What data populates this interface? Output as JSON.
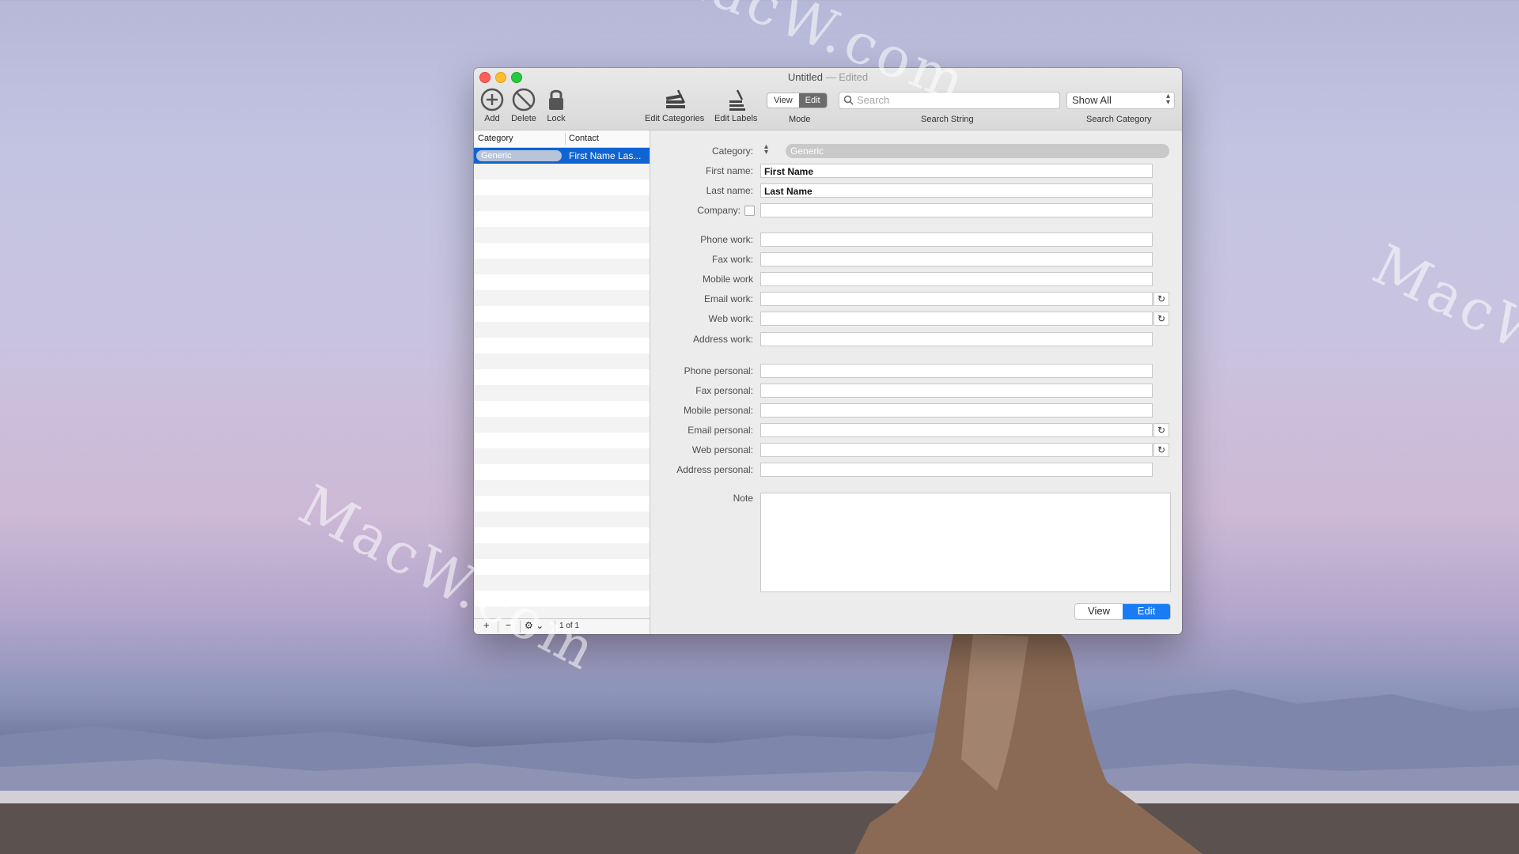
{
  "window": {
    "title": "Untitled",
    "title_suffix": "— Edited"
  },
  "toolbar": {
    "add_label": "Add",
    "delete_label": "Delete",
    "lock_label": "Lock",
    "edit_categories_label": "Edit Categories",
    "edit_labels_label": "Edit Labels",
    "mode_view": "View",
    "mode_edit": "Edit",
    "mode_caption": "Mode",
    "search_placeholder": "Search",
    "search_caption": "Search String",
    "category_value": "Show All",
    "category_caption": "Search Category"
  },
  "list": {
    "headers": [
      "Category",
      "Contact"
    ],
    "rows": [
      {
        "category": "Generic",
        "contact": "First Name Las..."
      }
    ],
    "footer_count": "1 of 1"
  },
  "form": {
    "category_label": "Category:",
    "category_value": "Generic",
    "fields": [
      {
        "label": "First name:",
        "value": "First Name"
      },
      {
        "label": "Last name:",
        "value": "Last Name"
      },
      {
        "label": "Company:",
        "value": ""
      },
      {
        "label": "Phone work:",
        "value": ""
      },
      {
        "label": "Fax work:",
        "value": ""
      },
      {
        "label": "Mobile work",
        "value": ""
      },
      {
        "label": "Email work:",
        "value": ""
      },
      {
        "label": "Web work:",
        "value": ""
      },
      {
        "label": "Address work:",
        "value": ""
      },
      {
        "label": "Phone personal:",
        "value": ""
      },
      {
        "label": "Fax personal:",
        "value": ""
      },
      {
        "label": "Mobile personal:",
        "value": ""
      },
      {
        "label": "Email personal:",
        "value": ""
      },
      {
        "label": "Web personal:",
        "value": ""
      },
      {
        "label": "Address personal:",
        "value": ""
      }
    ],
    "note_label": "Note",
    "note_value": "",
    "mode_view": "View",
    "mode_edit": "Edit"
  },
  "watermark": "MacW.com",
  "colors": {
    "selection": "#0f64d2",
    "accent": "#1a7cf5"
  }
}
